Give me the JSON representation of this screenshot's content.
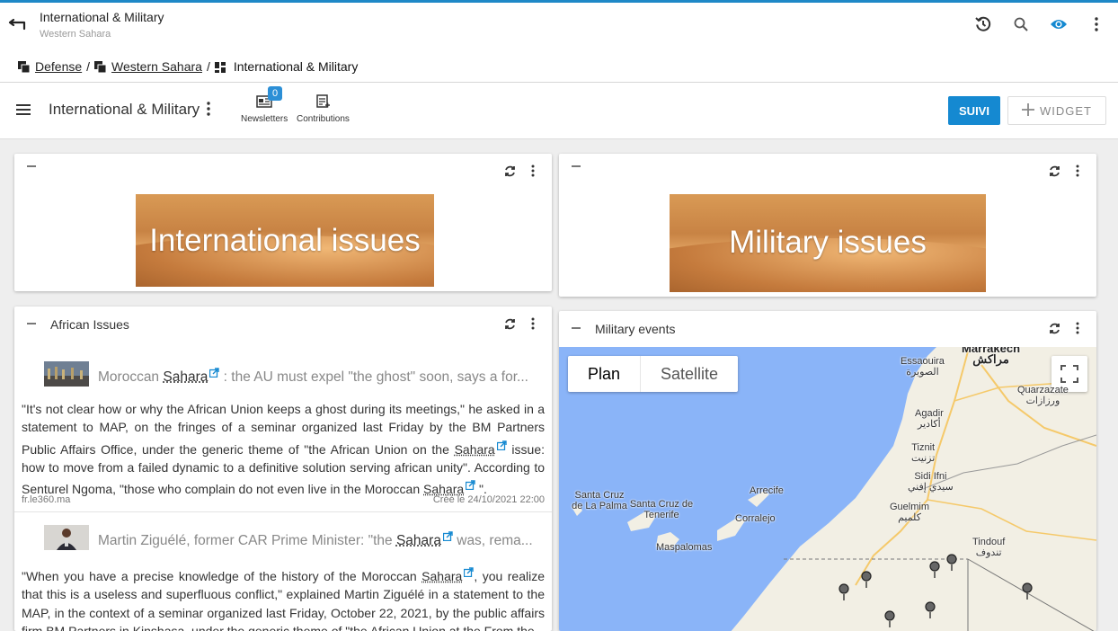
{
  "header": {
    "title": "International & Military",
    "subtitle": "Western Sahara"
  },
  "breadcrumb": {
    "items": [
      "Defense",
      "Western Sahara",
      "International & Military"
    ],
    "separator": "/"
  },
  "toolbar": {
    "title": "International & Military",
    "newsletters_label": "Newsletters",
    "newsletters_count": "0",
    "contributions_label": "Contributions",
    "suivi_label": "SUIVI",
    "widget_label": "WIDGET"
  },
  "widgets": {
    "international_banner_text": "International issues",
    "military_banner_text": "Military issues",
    "african_issues": {
      "title": "African Issues",
      "items": [
        {
          "headline_pre": "Moroccan ",
          "headline_kw": "Sahara",
          "headline_post": " : the AU must expel \"the ghost\" soon, says a for...",
          "body_1": "\"It's not clear how or why the African Union keeps a ghost during its meetings,\" he asked in a statement to MAP, on the fringes of a seminar organized last Friday by the BM Partners Public Affairs Office, under the generic theme of \"the African Union on the ",
          "body_kw_1": "Sahara",
          "body_2": " issue: how to move from a failed dynamic to a definitive solution serving african unity\". According to Senturel Ngoma, \"those who complain do not even live in the Moroccan ",
          "body_kw_2": "Sahara",
          "body_3": " \".",
          "source": "fr.le360.ma",
          "created": "Créé le 24/10/2021 22:00"
        },
        {
          "headline_pre": "Martin Ziguélé, former CAR Prime Minister: \"the ",
          "headline_kw": "Sahara",
          "headline_post": " was, rema...",
          "body_1": "\"When you have a precise knowledge of the history of the Moroccan ",
          "body_kw_1": "Sahara",
          "body_2": ", you realize that this is a useless and superfluous conflict,\" explained Martin Ziguélé in a statement to the MAP, in the context of a seminar organized last Friday, October 22, 2021, by the public affairs firm BM Partners in Kinshasa, under the generic theme of \"the African Union at the From the"
        }
      ]
    },
    "military_events": {
      "title": "Military events",
      "map_type_plan": "Plan",
      "map_type_satellite": "Satellite",
      "places": [
        {
          "name": "Marrakech",
          "local": "مراكش"
        },
        {
          "name": "Essaouira",
          "local": "الصويرة"
        },
        {
          "name": "Quarzazate",
          "local": "ورزازات"
        },
        {
          "name": "Agadir",
          "local": "أكادير"
        },
        {
          "name": "Tiznit",
          "local": "تزنيت"
        },
        {
          "name": "Sidi Ifni",
          "local": "سيدي إفني"
        },
        {
          "name": "Guelmim",
          "local": "كلميم"
        },
        {
          "name": "Tindouf",
          "local": "تندوف"
        },
        {
          "name": "Santa Cruz de La Palma",
          "local": ""
        },
        {
          "name": "Santa Cruz de Tenerife",
          "local": ""
        },
        {
          "name": "Arrecife",
          "local": ""
        },
        {
          "name": "Corralejo",
          "local": ""
        },
        {
          "name": "Maspalomas",
          "local": ""
        }
      ]
    }
  },
  "colors": {
    "accent": "#1589d1",
    "top_border": "#1e88c7",
    "ocean": "#8ab4f8",
    "land": "#f2efe4"
  }
}
